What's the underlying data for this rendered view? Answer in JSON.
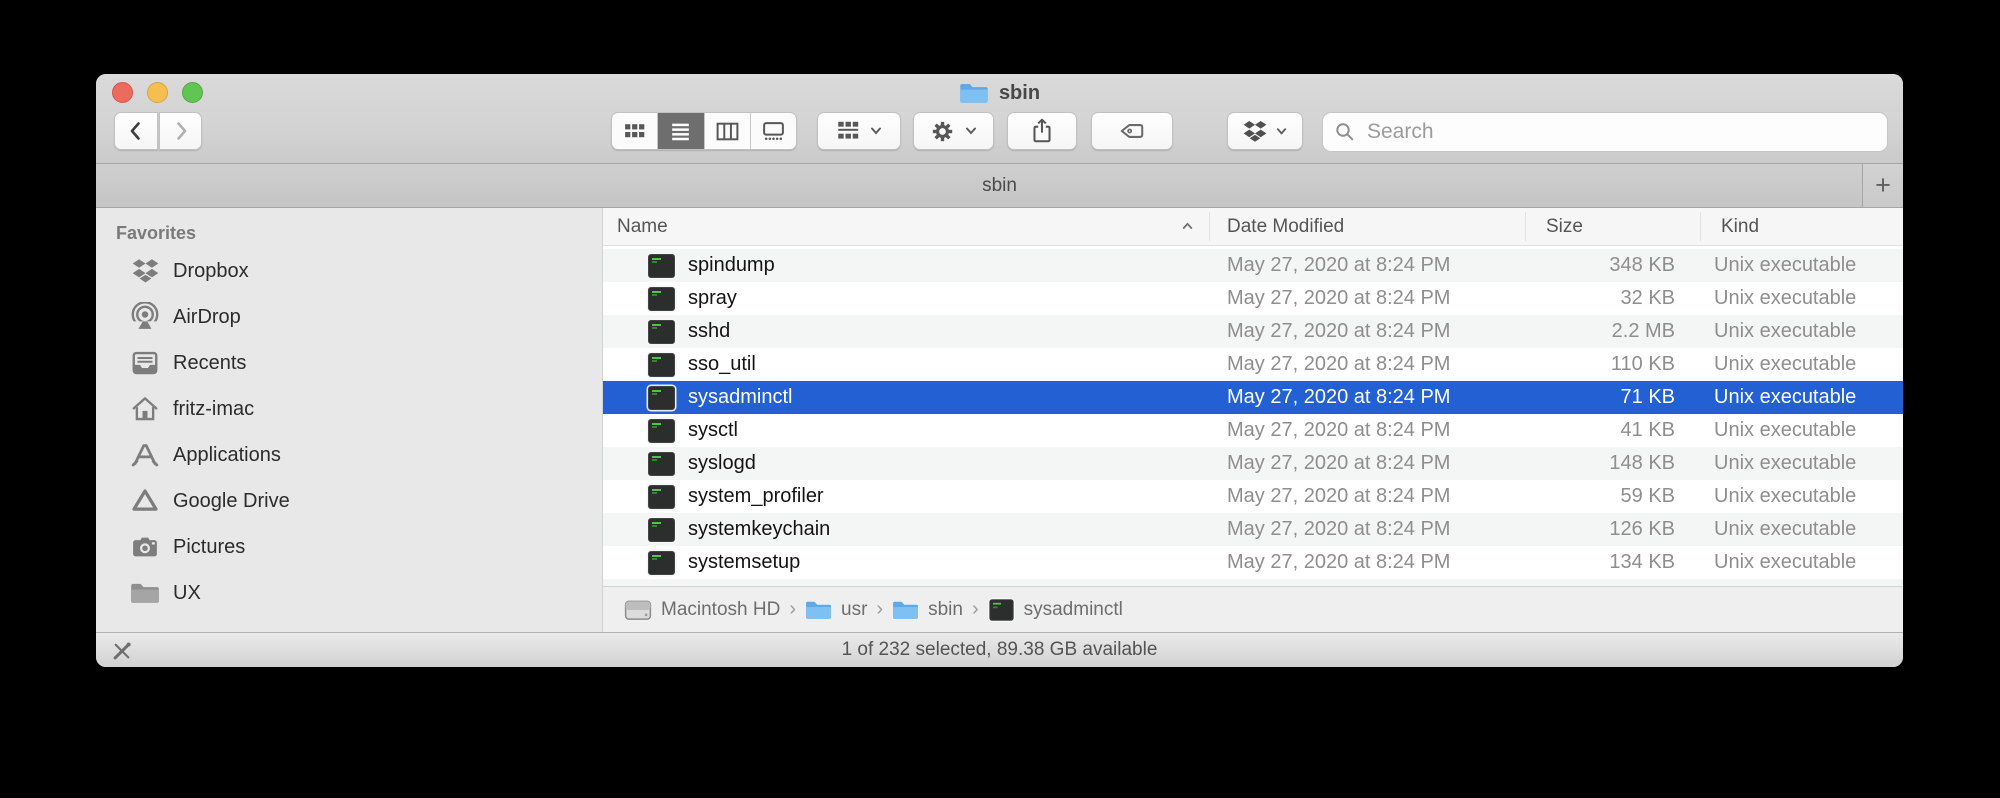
{
  "window": {
    "title": "sbin"
  },
  "toolbar": {
    "search_placeholder": "Search"
  },
  "tabbar": {
    "tab_label": "sbin",
    "add_label": "+"
  },
  "sidebar": {
    "section_label": "Favorites",
    "items": [
      {
        "label": "Dropbox",
        "icon": "dropbox-icon"
      },
      {
        "label": "AirDrop",
        "icon": "airdrop-icon"
      },
      {
        "label": "Recents",
        "icon": "recents-icon"
      },
      {
        "label": "fritz-imac",
        "icon": "home-icon"
      },
      {
        "label": "Applications",
        "icon": "applications-icon"
      },
      {
        "label": "Google Drive",
        "icon": "google-drive-icon"
      },
      {
        "label": "Pictures",
        "icon": "pictures-icon"
      },
      {
        "label": "UX",
        "icon": "folder-icon"
      }
    ]
  },
  "list": {
    "columns": {
      "name": "Name",
      "date_modified": "Date Modified",
      "size": "Size",
      "kind": "Kind"
    },
    "sort": {
      "column": "Name",
      "direction": "ascending"
    },
    "rows": [
      {
        "name": "spindump",
        "date": "May 27, 2020 at 8:24 PM",
        "size": "348 KB",
        "kind": "Unix executable",
        "selected": false
      },
      {
        "name": "spray",
        "date": "May 27, 2020 at 8:24 PM",
        "size": "32 KB",
        "kind": "Unix executable",
        "selected": false
      },
      {
        "name": "sshd",
        "date": "May 27, 2020 at 8:24 PM",
        "size": "2.2 MB",
        "kind": "Unix executable",
        "selected": false
      },
      {
        "name": "sso_util",
        "date": "May 27, 2020 at 8:24 PM",
        "size": "110 KB",
        "kind": "Unix executable",
        "selected": false
      },
      {
        "name": "sysadminctl",
        "date": "May 27, 2020 at 8:24 PM",
        "size": "71 KB",
        "kind": "Unix executable",
        "selected": true
      },
      {
        "name": "sysctl",
        "date": "May 27, 2020 at 8:24 PM",
        "size": "41 KB",
        "kind": "Unix executable",
        "selected": false
      },
      {
        "name": "syslogd",
        "date": "May 27, 2020 at 8:24 PM",
        "size": "148 KB",
        "kind": "Unix executable",
        "selected": false
      },
      {
        "name": "system_profiler",
        "date": "May 27, 2020 at 8:24 PM",
        "size": "59 KB",
        "kind": "Unix executable",
        "selected": false
      },
      {
        "name": "systemkeychain",
        "date": "May 27, 2020 at 8:24 PM",
        "size": "126 KB",
        "kind": "Unix executable",
        "selected": false
      },
      {
        "name": "systemsetup",
        "date": "May 27, 2020 at 8:24 PM",
        "size": "134 KB",
        "kind": "Unix executable",
        "selected": false
      }
    ]
  },
  "pathbar": {
    "items": [
      {
        "label": "Macintosh HD",
        "icon": "hard-drive-icon"
      },
      {
        "label": "usr",
        "icon": "folder-icon"
      },
      {
        "label": "sbin",
        "icon": "folder-icon"
      },
      {
        "label": "sysadminctl",
        "icon": "unix-executable-icon"
      }
    ]
  },
  "statusbar": {
    "text": "1 of 232 selected, 89.38 GB available"
  },
  "colors": {
    "selection_blue": "#2260d4",
    "folder_blue": "#74b9ef",
    "traffic_red": "#ed6a5e",
    "traffic_yellow": "#f4bf50",
    "traffic_green": "#61c554"
  }
}
